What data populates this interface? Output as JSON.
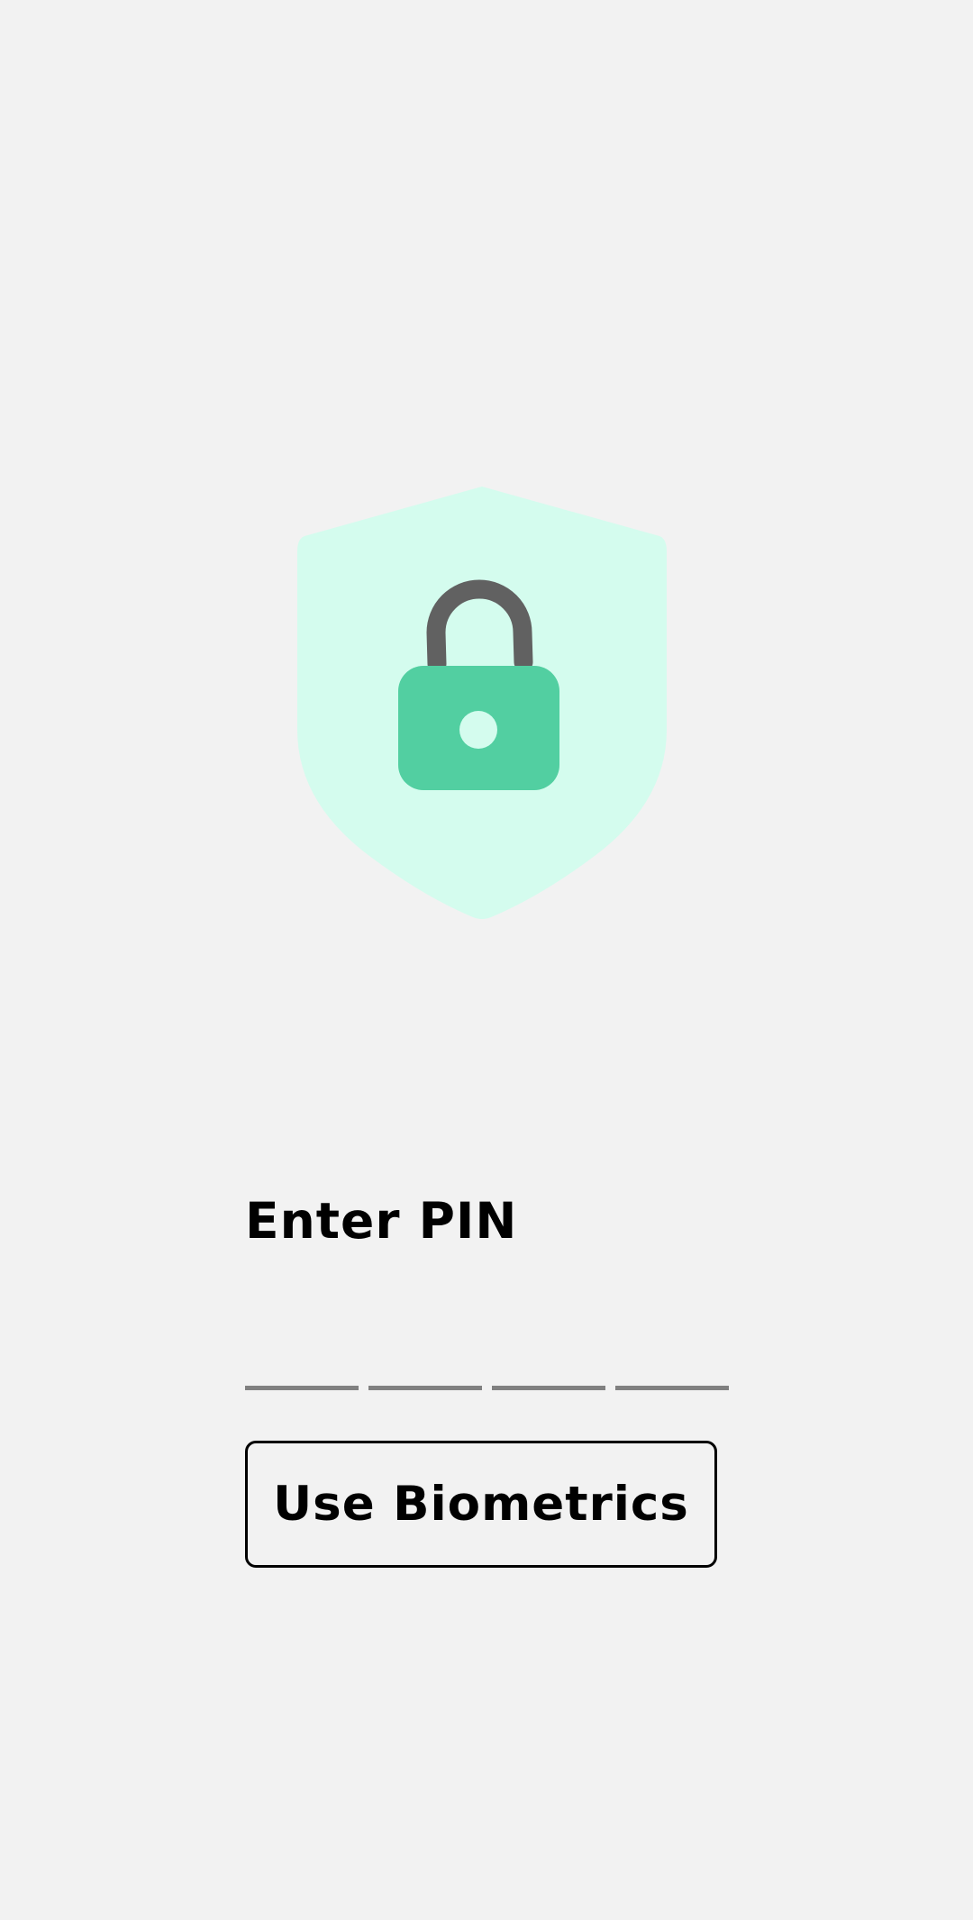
{
  "illustration": {
    "shield_icon": "shield-icon",
    "lock_icon": "lock-icon",
    "colors": {
      "shield": "#d4fcee",
      "lock_body": "#52cfa1",
      "shackle": "#616161",
      "keyhole": "#d4fcee"
    }
  },
  "pin": {
    "title": "Enter PIN",
    "digits_entered": 0,
    "digit_count": 4,
    "slot_color": "#808080"
  },
  "actions": {
    "biometrics_label": "Use Biometrics"
  },
  "theme": {
    "background": "#f2f2f2",
    "text": "#000000"
  }
}
